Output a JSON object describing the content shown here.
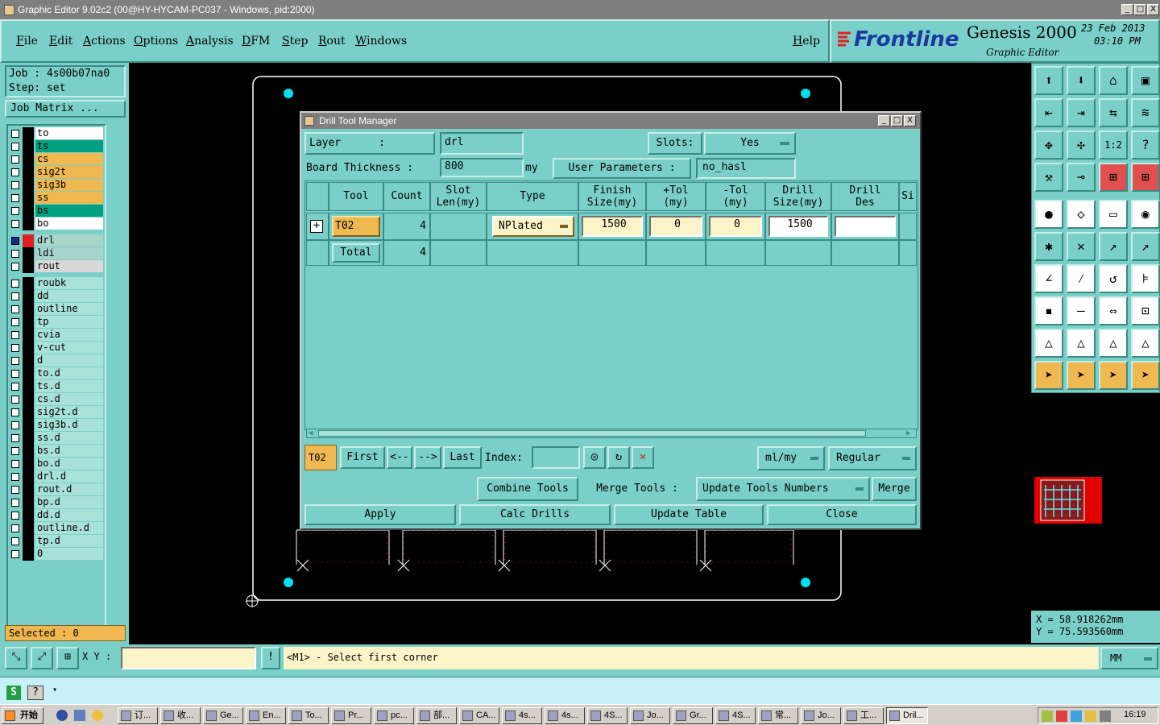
{
  "window": {
    "title": "Graphic Editor 9.02c2 (00@HY-HYCAM-PC037 - Windows, pid:2000)",
    "minimize": "_",
    "maximize": "□",
    "close": "X"
  },
  "menu": [
    "File",
    "Edit",
    "Actions",
    "Options",
    "Analysis",
    "DFM",
    "Step",
    "Rout",
    "Windows"
  ],
  "help_label": "Help",
  "brand": {
    "logo": "Frontline",
    "product": "Genesis 2000",
    "subtitle": "Graphic Editor",
    "date": "23 Feb 2013",
    "time": "03:10 PM"
  },
  "job": {
    "job_label": "Job : 4s00b07na0",
    "step_label": "Step: set",
    "matrix_button": "Job Matrix ..."
  },
  "layers_board": [
    {
      "name": "to",
      "color": "#ffffff"
    },
    {
      "name": "ts",
      "color": "#00a080"
    },
    {
      "name": "cs",
      "color": "#f0b850"
    },
    {
      "name": "sig2t",
      "color": "#f0b850"
    },
    {
      "name": "sig3b",
      "color": "#f0b850"
    },
    {
      "name": "ss",
      "color": "#f0b850"
    },
    {
      "name": "bs",
      "color": "#00a080"
    },
    {
      "name": "bo",
      "color": "#ffffff"
    }
  ],
  "layers_drill": [
    {
      "name": "drl",
      "color": "#a8d4cc"
    },
    {
      "name": "ldi",
      "color": "#a8d4cc"
    },
    {
      "name": "rout",
      "color": "#d8d8d8"
    }
  ],
  "layers_misc": [
    "roubk",
    "dd",
    "outline",
    "tp",
    "cvia",
    "v-cut",
    "d",
    "to.d",
    "ts.d",
    "cs.d",
    "sig2t.d",
    "sig3b.d",
    "ss.d",
    "bs.d",
    "bo.d",
    "drl.d",
    "rout.d",
    "bp.d",
    "dd.d",
    "outline.d",
    "tp.d",
    "0"
  ],
  "selected_label": "Selected : 0",
  "dialog": {
    "title": "Drill Tool Manager",
    "layer_label": "Layer      :",
    "layer_value": "drl",
    "slots_label": "Slots:",
    "slots_value": "Yes",
    "thickness_label": "Board Thickness :",
    "thickness_value": "800",
    "thickness_unit": "my",
    "user_params_label": "User Parameters :",
    "user_params_value": "no_hasl",
    "columns": [
      "Tool",
      "Count",
      "Slot\nLen(my)",
      "Type",
      "Finish\nSize(my)",
      "+Tol\n(my)",
      "-Tol\n(my)",
      "Drill\nSize(my)",
      "Drill\nDes",
      "Si"
    ],
    "rows": [
      {
        "tool": "T02",
        "count": "4",
        "slot_len": "",
        "type": "NPlated",
        "finish": "1500",
        "tol_plus": "0",
        "tol_minus": "0",
        "drill": "1500",
        "des": ""
      }
    ],
    "total_label": "Total",
    "total_count": "4",
    "nav": {
      "current": "T02",
      "first": "First",
      "prev": "<--",
      "next": "-->",
      "last": "Last",
      "index_label": "Index:",
      "units": "ml/my",
      "mode": "Regular"
    },
    "actions": {
      "combine": "Combine Tools",
      "merge_label": "Merge Tools :",
      "update_numbers": "Update Tools Numbers",
      "merge": "Merge"
    },
    "footer": {
      "apply": "Apply",
      "calc": "Calc Drills",
      "update": "Update Table",
      "close": "Close"
    }
  },
  "coords": {
    "x": "X = 58.918262mm",
    "y": "Y = 75.593560mm"
  },
  "status": {
    "xy_label": "X Y :",
    "prompt": "<M1> - Select first corner",
    "units": "MM"
  },
  "taskbar": {
    "start": "开始",
    "tasks": [
      "订...",
      "收...",
      "Ge...",
      "En...",
      "To...",
      "Pr...",
      "pc...",
      "部...",
      "CA...",
      "4s...",
      "4s...",
      "4S...",
      "Jo...",
      "Gr...",
      "4S...",
      "常...",
      "Jo...",
      "工...",
      "Dril..."
    ],
    "clock": "16:19"
  }
}
